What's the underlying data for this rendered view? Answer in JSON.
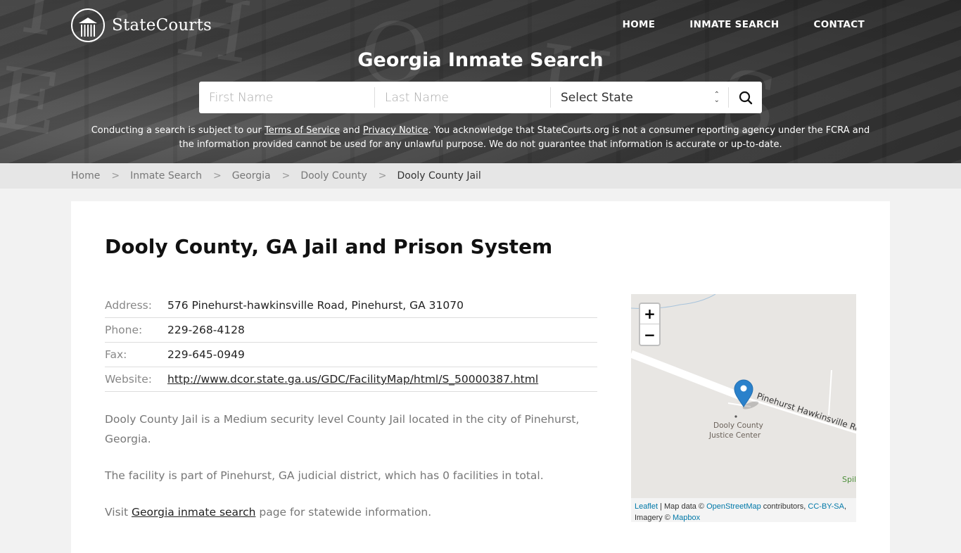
{
  "header": {
    "logo_text": "StateCourts",
    "nav": [
      "HOME",
      "INMATE SEARCH",
      "CONTACT"
    ],
    "title": "Georgia Inmate Search",
    "search": {
      "first_name_placeholder": "First Name",
      "last_name_placeholder": "Last Name",
      "state_select_value": "Select State"
    },
    "disclaimer": {
      "part1": "Conducting a search is subject to our ",
      "terms_link": "Terms of Service",
      "part2": " and ",
      "privacy_link": "Privacy Notice",
      "part3": ". You acknowledge that StateCourts.org is not a consumer reporting agency under the FCRA and the information provided cannot be used for any unlawful purpose. We do not guarantee that information is accurate or up-to-date."
    }
  },
  "breadcrumb": [
    "Home",
    "Inmate Search",
    "Georgia",
    "Dooly County",
    "Dooly County Jail"
  ],
  "main": {
    "title": "Dooly County, GA Jail and Prison System",
    "info": [
      {
        "label": "Address:",
        "value": "576 Pinehurst-hawkinsville Road, Pinehurst, GA 31070"
      },
      {
        "label": "Phone:",
        "value": "229-268-4128"
      },
      {
        "label": "Fax:",
        "value": "229-645-0949"
      },
      {
        "label": "Website:",
        "value": "http://www.dcor.state.ga.us/GDC/FacilityMap/html/S_50000387.html"
      }
    ],
    "paragraphs": {
      "p1": "Dooly County Jail is a Medium security level County Jail located in the city of Pinehurst, Georgia.",
      "p2": "The facility is part of Pinehurst, GA judicial district, which has 0 facilities in total.",
      "p3_before": "Visit ",
      "p3_link": "Georgia inmate search",
      "p3_after": " page for statewide information."
    }
  },
  "map": {
    "zoom_in": "+",
    "zoom_out": "−",
    "road_label": "Pinehurst Hawkinsville Ro",
    "place_label_line1": "Dooly County",
    "place_label_line2": "Justice Center",
    "corner_label": "Spil",
    "attribution": {
      "leaflet": "Leaflet",
      "sep1": " | Map data © ",
      "osm": "OpenStreetMap",
      "sep2": " contributors, ",
      "license": "CC-BY-SA",
      "sep3": ", Imagery © ",
      "mapbox": "Mapbox"
    },
    "colors": {
      "marker": "#2a81cb",
      "link": "#0078a8",
      "land": "#e8e6e3"
    }
  }
}
